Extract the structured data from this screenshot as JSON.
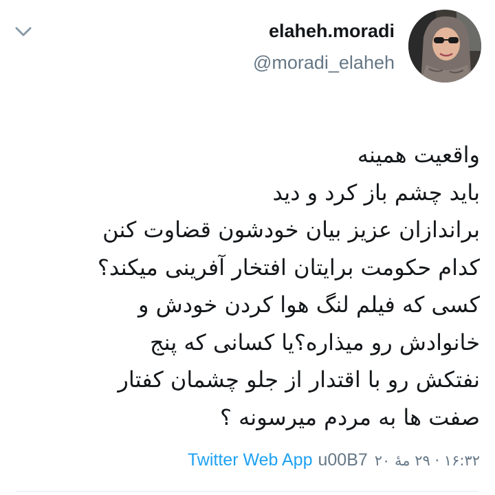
{
  "user": {
    "display_name": "elaheh.moradi",
    "handle": "@moradi_elaheh"
  },
  "icons": {
    "menu": "chevron-down-icon",
    "avatar": "profile-photo"
  },
  "tweet": {
    "lines": [
      "واقعیت همینه",
      "باید چشم باز کرد و دید",
      "براندازان عزیز بیان خودشون قضاوت کنن",
      "کدام حکومت برایتان افتخار آفرینی میکند؟",
      "کسی که فیلم لنگ هوا کردن خودش و",
      "خانوادش رو میذاره؟یا کسانی که پنج",
      "نفتکش رو با اقتدار از جلو چشمان کفتار",
      "صفت ها به مردم میرسونه ؟"
    ]
  },
  "footer": {
    "source": "Twitter Web App",
    "separator": "u00B7",
    "timestamp": "۱۶:۳۲ · ۲۹ مهٔ ۲۰"
  },
  "colors": {
    "text": "#14171a",
    "secondary": "#657786",
    "link": "#1da1f2",
    "divider": "#e1e8ed"
  }
}
